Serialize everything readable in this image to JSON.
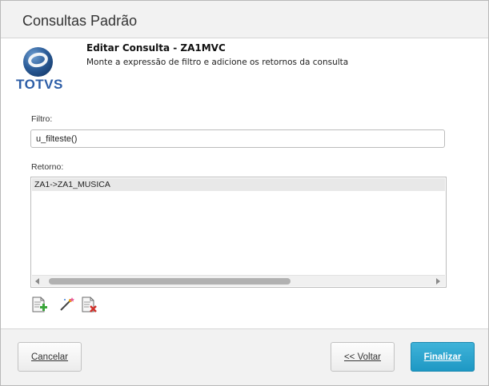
{
  "window": {
    "title": "Consultas Padrão"
  },
  "logo": {
    "brand": "TOTVS"
  },
  "header": {
    "title": "Editar Consulta - ZA1MVC",
    "subtitle": "Monte a expressão de filtro e adicione os retornos da consulta"
  },
  "filter": {
    "label": "Filtro:",
    "value": "u_filteste()"
  },
  "returns": {
    "label": "Retorno:",
    "items": [
      "ZA1->ZA1_MUSICA"
    ]
  },
  "toolbar": {
    "icons": [
      "add-document-icon",
      "edit-wand-icon",
      "delete-document-icon"
    ]
  },
  "footer": {
    "cancel_label": "Cancelar",
    "back_label": "<< Voltar",
    "finish_label": "Finalizar"
  },
  "colors": {
    "accent": "#2aa6cf",
    "brand": "#2c5da6"
  }
}
